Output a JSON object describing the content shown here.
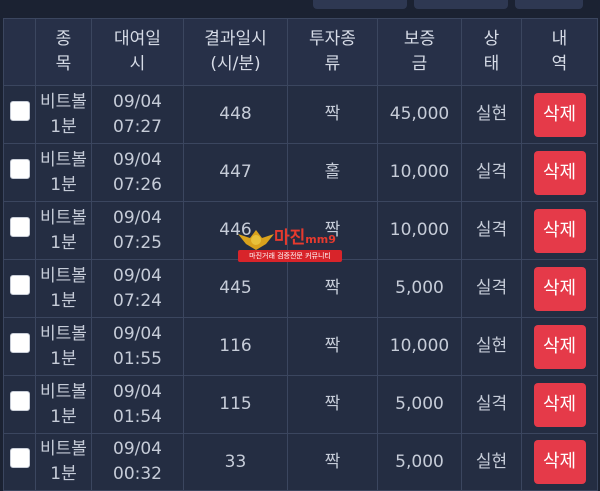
{
  "headers": {
    "game": [
      "종",
      "목"
    ],
    "date": [
      "대여일",
      "시"
    ],
    "result_time": [
      "결과일시",
      "(시/분)"
    ],
    "type": [
      "투자종",
      "류"
    ],
    "amount": [
      "보증",
      "금"
    ],
    "status": [
      "상",
      "태"
    ],
    "action": [
      "내",
      "역"
    ]
  },
  "rows": [
    {
      "game": [
        "비트볼",
        "1분"
      ],
      "date": [
        "09/04",
        "07:27"
      ],
      "result": "448",
      "type": "짝",
      "amount": "45,000",
      "status": "실현",
      "status_kind": "win",
      "action": "삭제"
    },
    {
      "game": [
        "비트볼",
        "1분"
      ],
      "date": [
        "09/04",
        "07:26"
      ],
      "result": "447",
      "type": "홀",
      "amount": "10,000",
      "status": "실격",
      "status_kind": "lose",
      "action": "삭제"
    },
    {
      "game": [
        "비트볼",
        "1분"
      ],
      "date": [
        "09/04",
        "07:25"
      ],
      "result": "446",
      "type": "짝",
      "amount": "10,000",
      "status": "실격",
      "status_kind": "lose",
      "action": "삭제"
    },
    {
      "game": [
        "비트볼",
        "1분"
      ],
      "date": [
        "09/04",
        "07:24"
      ],
      "result": "445",
      "type": "짝",
      "amount": "5,000",
      "status": "실격",
      "status_kind": "lose",
      "action": "삭제"
    },
    {
      "game": [
        "비트볼",
        "1분"
      ],
      "date": [
        "09/04",
        "01:55"
      ],
      "result": "116",
      "type": "짝",
      "amount": "10,000",
      "status": "실현",
      "status_kind": "win",
      "action": "삭제"
    },
    {
      "game": [
        "비트볼",
        "1분"
      ],
      "date": [
        "09/04",
        "01:54"
      ],
      "result": "115",
      "type": "짝",
      "amount": "5,000",
      "status": "실격",
      "status_kind": "lose",
      "action": "삭제"
    },
    {
      "game": [
        "비트볼",
        "1분"
      ],
      "date": [
        "09/04",
        "00:32"
      ],
      "result": "33",
      "type": "짝",
      "amount": "5,000",
      "status": "실현",
      "status_kind": "win",
      "action": "삭제"
    }
  ],
  "watermark": {
    "title": "마진",
    "title_suffix": "mm9",
    "subtitle": "마진거래 검증전문 커뮤니티"
  },
  "colors": {
    "background": "#1b2232",
    "win": "#3fb565",
    "lose": "#e0404a",
    "delete_button": "#e53a49"
  }
}
